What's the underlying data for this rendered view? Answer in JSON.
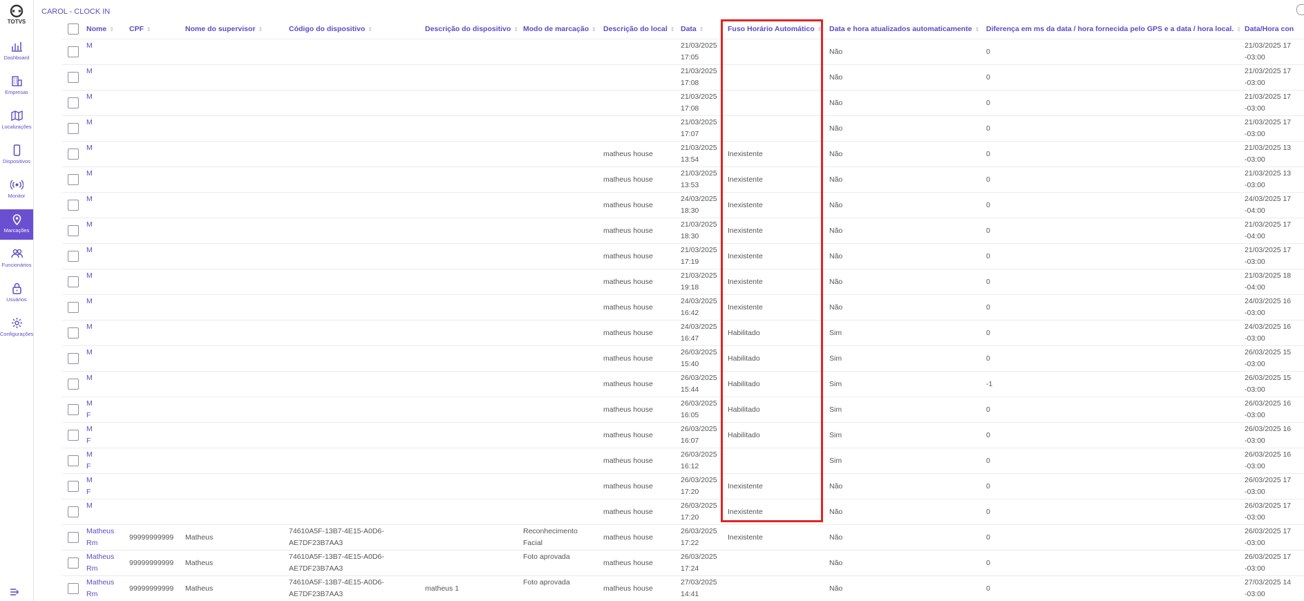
{
  "app": {
    "title": "CAROL - CLOCK IN",
    "logo_text": "TOTVS"
  },
  "sidebar": {
    "items": [
      {
        "label": "Dashboard",
        "icon": "chart-icon"
      },
      {
        "label": "Empresas",
        "icon": "building-icon"
      },
      {
        "label": "Localizações",
        "icon": "map-icon"
      },
      {
        "label": "Dispositivos",
        "icon": "phone-icon"
      },
      {
        "label": "Monitor",
        "icon": "broadcast-icon"
      },
      {
        "label": "Marcações",
        "icon": "location-pin-icon",
        "active": true
      },
      {
        "label": "Funcionários",
        "icon": "users-icon"
      },
      {
        "label": "Usuários",
        "icon": "lock-icon"
      },
      {
        "label": "Configurações",
        "icon": "gear-icon"
      }
    ]
  },
  "table": {
    "headers": {
      "nome": "Nome",
      "cpf": "CPF",
      "supervisor": "Nome do supervisor",
      "codigo": "Código do dispositivo",
      "descricao_disp": "Descrição do dispositivo",
      "modo": "Modo de marcação",
      "local": "Descrição do local",
      "data": "Data",
      "fuso": "Fuso Horário Automático",
      "data_auto": "Data e hora atualizados automaticamente",
      "diferenca": "Diferença em ms da data / hora fornecida pelo GPS e a data / hora local.",
      "datahora": "Data/Hora con"
    },
    "rows": [
      {
        "nome": "M",
        "nome2": "",
        "cpf": "",
        "supervisor": "",
        "codigo1": "",
        "codigo2": "",
        "descricao_disp": "",
        "modo1": "",
        "modo2": "",
        "local": "",
        "data1": "21/03/2025",
        "data2": "17:05",
        "fuso": "",
        "data_auto": "Não",
        "diferenca": "0",
        "dh1": "21/03/2025 17",
        "dh2": "-03:00"
      },
      {
        "nome": "M",
        "nome2": "",
        "cpf": "",
        "supervisor": "",
        "codigo1": "",
        "codigo2": "",
        "descricao_disp": "",
        "modo1": "",
        "modo2": "",
        "local": "",
        "data1": "21/03/2025",
        "data2": "17:08",
        "fuso": "",
        "data_auto": "Não",
        "diferenca": "0",
        "dh1": "21/03/2025 17",
        "dh2": "-03:00"
      },
      {
        "nome": "M",
        "nome2": "",
        "cpf": "",
        "supervisor": "",
        "codigo1": "",
        "codigo2": "",
        "descricao_disp": "",
        "modo1": "",
        "modo2": "",
        "local": "",
        "data1": "21/03/2025",
        "data2": "17:08",
        "fuso": "",
        "data_auto": "Não",
        "diferenca": "0",
        "dh1": "21/03/2025 17",
        "dh2": "-03:00"
      },
      {
        "nome": "M",
        "nome2": "",
        "cpf": "",
        "supervisor": "",
        "codigo1": "",
        "codigo2": "",
        "descricao_disp": "",
        "modo1": "",
        "modo2": "",
        "local": "",
        "data1": "21/03/2025",
        "data2": "17:07",
        "fuso": "",
        "data_auto": "Não",
        "diferenca": "0",
        "dh1": "21/03/2025 17",
        "dh2": "-03:00"
      },
      {
        "nome": "M",
        "nome2": "",
        "cpf": "",
        "supervisor": "",
        "codigo1": "",
        "codigo2": "",
        "descricao_disp": "",
        "modo1": "",
        "modo2": "",
        "local": "matheus house",
        "data1": "21/03/2025",
        "data2": "13:54",
        "fuso": "Inexistente",
        "data_auto": "Não",
        "diferenca": "0",
        "dh1": "21/03/2025 13",
        "dh2": "-03:00"
      },
      {
        "nome": "M",
        "nome2": "",
        "cpf": "",
        "supervisor": "",
        "codigo1": "",
        "codigo2": "",
        "descricao_disp": "",
        "modo1": "",
        "modo2": "",
        "local": "matheus house",
        "data1": "21/03/2025",
        "data2": "13:53",
        "fuso": "Inexistente",
        "data_auto": "Não",
        "diferenca": "0",
        "dh1": "21/03/2025 13",
        "dh2": "-03:00"
      },
      {
        "nome": "M",
        "nome2": "",
        "cpf": "",
        "supervisor": "",
        "codigo1": "",
        "codigo2": "",
        "descricao_disp": "",
        "modo1": "",
        "modo2": "",
        "local": "matheus house",
        "data1": "24/03/2025",
        "data2": "18:30",
        "fuso": "Inexistente",
        "data_auto": "Não",
        "diferenca": "0",
        "dh1": "24/03/2025 17",
        "dh2": "-04:00"
      },
      {
        "nome": "M",
        "nome2": "",
        "cpf": "",
        "supervisor": "",
        "codigo1": "",
        "codigo2": "",
        "descricao_disp": "",
        "modo1": "",
        "modo2": "",
        "local": "matheus house",
        "data1": "21/03/2025",
        "data2": "18:30",
        "fuso": "Inexistente",
        "data_auto": "Não",
        "diferenca": "0",
        "dh1": "21/03/2025 17",
        "dh2": "-04:00"
      },
      {
        "nome": "M",
        "nome2": "",
        "cpf": "",
        "supervisor": "",
        "codigo1": "",
        "codigo2": "",
        "descricao_disp": "",
        "modo1": "",
        "modo2": "",
        "local": "matheus house",
        "data1": "21/03/2025",
        "data2": "17:19",
        "fuso": "Inexistente",
        "data_auto": "Não",
        "diferenca": "0",
        "dh1": "21/03/2025 17",
        "dh2": "-03:00"
      },
      {
        "nome": "M",
        "nome2": "",
        "cpf": "",
        "supervisor": "",
        "codigo1": "",
        "codigo2": "",
        "descricao_disp": "",
        "modo1": "",
        "modo2": "",
        "local": "matheus house",
        "data1": "21/03/2025",
        "data2": "19:18",
        "fuso": "Inexistente",
        "data_auto": "Não",
        "diferenca": "0",
        "dh1": "21/03/2025 18",
        "dh2": "-04:00"
      },
      {
        "nome": "M",
        "nome2": "",
        "cpf": "",
        "supervisor": "",
        "codigo1": "",
        "codigo2": "",
        "descricao_disp": "",
        "modo1": "",
        "modo2": "",
        "local": "matheus house",
        "data1": "24/03/2025",
        "data2": "16:42",
        "fuso": "Inexistente",
        "data_auto": "Não",
        "diferenca": "0",
        "dh1": "24/03/2025 16",
        "dh2": "-03:00"
      },
      {
        "nome": "M",
        "nome2": "",
        "cpf": "",
        "supervisor": "",
        "codigo1": "",
        "codigo2": "",
        "descricao_disp": "",
        "modo1": "",
        "modo2": "",
        "local": "matheus house",
        "data1": "24/03/2025",
        "data2": "16:47",
        "fuso": "Habilitado",
        "data_auto": "Sim",
        "diferenca": "0",
        "dh1": "24/03/2025 16",
        "dh2": "-03:00"
      },
      {
        "nome": "M",
        "nome2": "",
        "cpf": "",
        "supervisor": "",
        "codigo1": "",
        "codigo2": "",
        "descricao_disp": "",
        "modo1": "",
        "modo2": "",
        "local": "matheus house",
        "data1": "26/03/2025",
        "data2": "15:40",
        "fuso": "Habilitado",
        "data_auto": "Sim",
        "diferenca": "0",
        "dh1": "26/03/2025 15",
        "dh2": "-03:00"
      },
      {
        "nome": "M",
        "nome2": "",
        "cpf": "",
        "supervisor": "",
        "codigo1": "",
        "codigo2": "",
        "descricao_disp": "",
        "modo1": "",
        "modo2": "",
        "local": "matheus house",
        "data1": "26/03/2025",
        "data2": "15:44",
        "fuso": "Habilitado",
        "data_auto": "Sim",
        "diferenca": "-1",
        "dh1": "26/03/2025 15",
        "dh2": "-03:00"
      },
      {
        "nome": "M",
        "nome2": "F",
        "cpf": "",
        "supervisor": "",
        "codigo1": "",
        "codigo2": "",
        "descricao_disp": "",
        "modo1": "",
        "modo2": "",
        "local": "matheus house",
        "data1": "26/03/2025",
        "data2": "16:05",
        "fuso": "Habilitado",
        "data_auto": "Sim",
        "diferenca": "0",
        "dh1": "26/03/2025 16",
        "dh2": "-03:00"
      },
      {
        "nome": "M",
        "nome2": "F",
        "cpf": "",
        "supervisor": "",
        "codigo1": "",
        "codigo2": "",
        "descricao_disp": "",
        "modo1": "",
        "modo2": "",
        "local": "matheus house",
        "data1": "26/03/2025",
        "data2": "16:07",
        "fuso": "Habilitado",
        "data_auto": "Sim",
        "diferenca": "0",
        "dh1": "26/03/2025 16",
        "dh2": "-03:00"
      },
      {
        "nome": "M",
        "nome2": "F",
        "cpf": "",
        "supervisor": "",
        "codigo1": "",
        "codigo2": "",
        "descricao_disp": "",
        "modo1": "",
        "modo2": "",
        "local": "matheus house",
        "data1": "26/03/2025",
        "data2": "16:12",
        "fuso": "",
        "data_auto": "Sim",
        "diferenca": "0",
        "dh1": "26/03/2025 16",
        "dh2": "-03:00"
      },
      {
        "nome": "M",
        "nome2": "F",
        "cpf": "",
        "supervisor": "",
        "codigo1": "",
        "codigo2": "",
        "descricao_disp": "",
        "modo1": "",
        "modo2": "",
        "local": "matheus house",
        "data1": "26/03/2025",
        "data2": "17:20",
        "fuso": "Inexistente",
        "data_auto": "Não",
        "diferenca": "0",
        "dh1": "26/03/2025 17",
        "dh2": "-03:00"
      },
      {
        "nome": "M",
        "nome2": "",
        "cpf": "",
        "supervisor": "",
        "codigo1": "",
        "codigo2": "",
        "descricao_disp": "",
        "modo1": "",
        "modo2": "",
        "local": "matheus house",
        "data1": "26/03/2025",
        "data2": "17:20",
        "fuso": "Inexistente",
        "data_auto": "Não",
        "diferenca": "0",
        "dh1": "26/03/2025 17",
        "dh2": "-03:00"
      },
      {
        "nome": "Matheus",
        "nome2": "Rm",
        "cpf": "99999999999",
        "supervisor": "Matheus",
        "codigo1": "74610A5F-13B7-4E15-A0D6-",
        "codigo2": "AE7DF23B7AA3",
        "descricao_disp": "",
        "modo1": "Reconhecimento",
        "modo2": "Facial",
        "local": "matheus house",
        "data1": "26/03/2025",
        "data2": "17:22",
        "fuso": "Inexistente",
        "data_auto": "Não",
        "diferenca": "0",
        "dh1": "26/03/2025 17",
        "dh2": "-03:00"
      },
      {
        "nome": "Matheus",
        "nome2": "Rm",
        "cpf": "99999999999",
        "supervisor": "Matheus",
        "codigo1": "74610A5F-13B7-4E15-A0D6-",
        "codigo2": "AE7DF23B7AA3",
        "descricao_disp": "",
        "modo1": "Foto aprovada",
        "modo2": "",
        "local": "matheus house",
        "data1": "26/03/2025",
        "data2": "17:24",
        "fuso": "",
        "data_auto": "Não",
        "diferenca": "0",
        "dh1": "26/03/2025 17",
        "dh2": "-03:00"
      },
      {
        "nome": "Matheus",
        "nome2": "Rm",
        "cpf": "99999999999",
        "supervisor": "Matheus",
        "codigo1": "74610A5F-13B7-4E15-A0D6-",
        "codigo2": "AE7DF23B7AA3",
        "descricao_disp": "matheus 1",
        "modo1": "Foto aprovada",
        "modo2": "",
        "local": "matheus house",
        "data1": "27/03/2025",
        "data2": "14:41",
        "fuso": "",
        "data_auto": "Não",
        "diferenca": "0",
        "dh1": "27/03/2025 14",
        "dh2": "-03:00"
      }
    ]
  },
  "colors": {
    "accent": "#5b4cc4",
    "sidebar_active": "#6a4fd0",
    "highlight": "#e32222"
  }
}
